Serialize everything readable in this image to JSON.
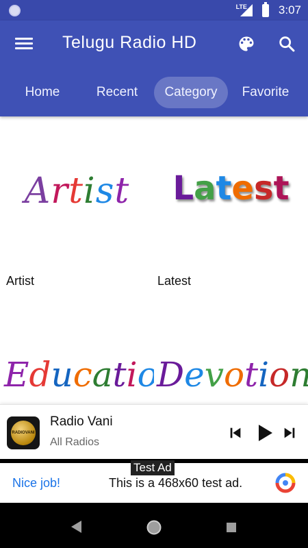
{
  "status_bar": {
    "network": "LTE",
    "time": "3:07"
  },
  "app_bar": {
    "title": "Telugu Radio HD",
    "icons": [
      "menu-icon",
      "palette-icon",
      "search-icon"
    ]
  },
  "tabs": [
    {
      "label": "Home",
      "active": false
    },
    {
      "label": "Recent",
      "active": false
    },
    {
      "label": "Category",
      "active": true
    },
    {
      "label": "Favorite",
      "active": false
    }
  ],
  "categories": [
    {
      "art_text": "Artist",
      "label": "Artist"
    },
    {
      "art_text": "Latest",
      "label": "Latest"
    },
    {
      "art_text": "Education",
      "label": ""
    },
    {
      "art_text": "Devotion",
      "label": ""
    }
  ],
  "player": {
    "station_name": "Radio Vani",
    "station_group": "All Radios",
    "logo_text": "RADIOVANI",
    "controls": [
      "skip-previous-icon",
      "play-icon",
      "skip-next-icon"
    ]
  },
  "ad": {
    "tag": "Test Ad",
    "headline": "Nice job!",
    "body": "This is a 468x60 test ad."
  },
  "colors": {
    "status_bar": "#3949ab",
    "app_bar": "#3f51b5",
    "ad_link": "#1a73e8"
  }
}
